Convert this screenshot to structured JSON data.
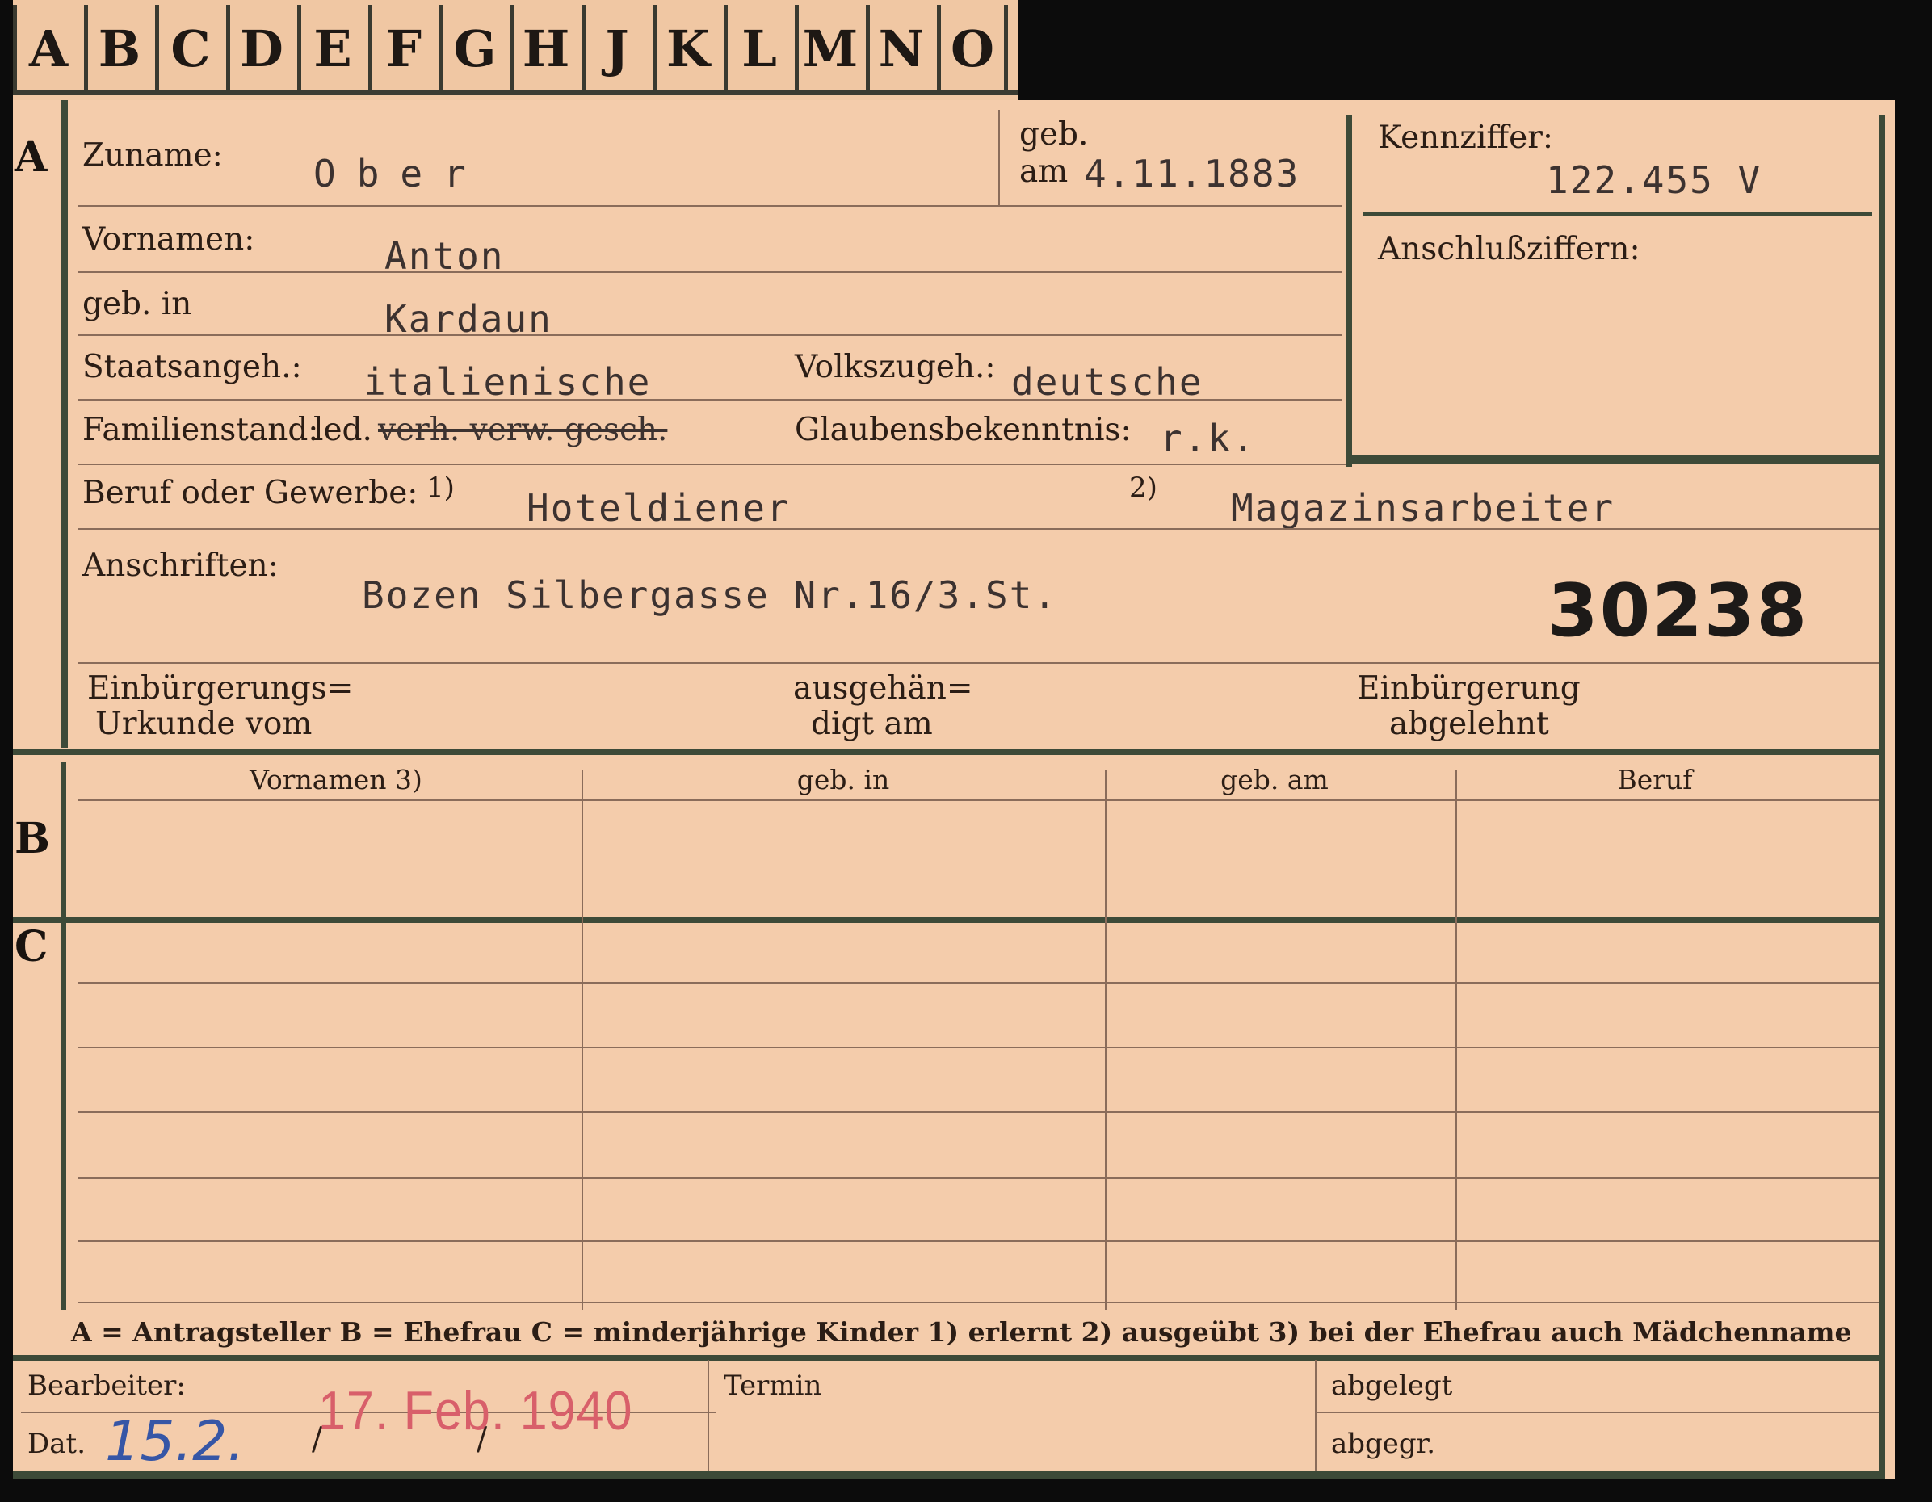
{
  "tabs": [
    "A",
    "B",
    "C",
    "D",
    "E",
    "F",
    "G",
    "H",
    "J",
    "K",
    "L",
    "M",
    "N",
    "O"
  ],
  "sections": {
    "a": "A",
    "b": "B",
    "c": "C"
  },
  "applicant": {
    "surname_label": "Zuname:",
    "surname": "Ober",
    "born_label_1": "geb.",
    "born_label_2": "am",
    "birth_date": "4.11.1883",
    "first_names_label": "Vornamen:",
    "first_names": "Anton",
    "birthplace_label": "geb. in",
    "birthplace": "Kardaun",
    "citizenship_label": "Staatsangeh.:",
    "citizenship": "italienische",
    "ethnicity_label": "Volkszugeh.:",
    "ethnicity": "deutsche",
    "marital_label": "Familienstand:",
    "marital_value": "led.",
    "marital_struck": "verh. verw. gesch.",
    "religion_label": "Glaubensbekenntnis:",
    "religion": "r.k.",
    "occupation_label": "Beruf oder Gewerbe:",
    "occ_marker_1": "1)",
    "occupation_learned": "Hoteldiener",
    "occ_marker_2": "2)",
    "occupation_practiced": "Magazinsarbeiter",
    "address_label": "Anschriften:",
    "address": "Bozen Silbergasse Nr.16/3.St.",
    "file_number": "30238",
    "naturalization_doc_1": "Einbürgerungs=",
    "naturalization_doc_2": "Urkunde vom",
    "handed_over_1": "ausgehän=",
    "handed_over_2": "digt am",
    "naturalization_refused_1": "Einbürgerung",
    "naturalization_refused_2": "abgelehnt"
  },
  "reference": {
    "code_label": "Kennziffer:",
    "code": "122.455 V",
    "linked_label": "Anschlußziffern:"
  },
  "columns": [
    "Vornamen 3)",
    "geb. in",
    "geb. am",
    "Beruf"
  ],
  "legend": "A = Antragsteller   B = Ehefrau   C = minderjährige Kinder   1) erlernt   2) ausgeübt   3) bei der Ehefrau auch Mädchenname",
  "footer": {
    "processor_label": "Bearbeiter:",
    "date_label": "Dat.",
    "handwritten_date": "15.2.",
    "stamp_date": "17. Feb. 1940",
    "slash_1": "/",
    "slash_2": "/",
    "deadline_label": "Termin",
    "filed_label": "abgelegt",
    "submitted_label": "abgegr."
  }
}
